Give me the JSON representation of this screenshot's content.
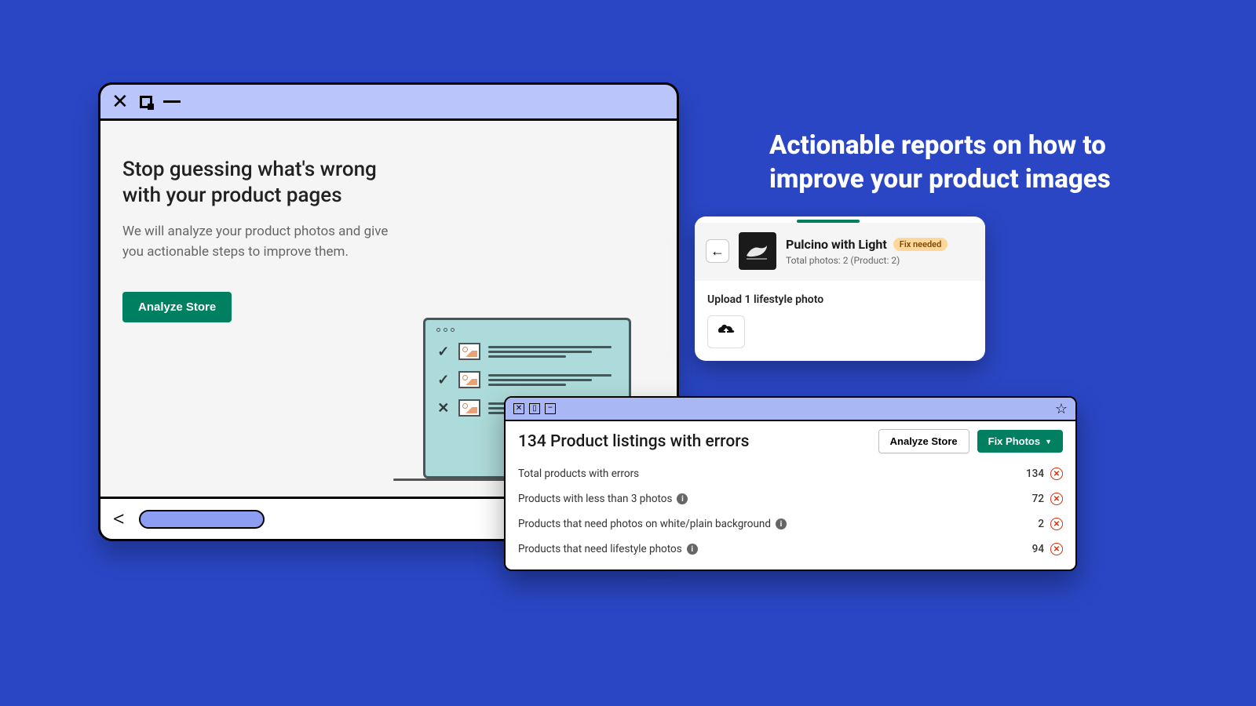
{
  "main": {
    "heading": "Stop guessing what's wrong with your product pages",
    "sub": "We will analyze your product photos and give you actionable steps to improve them.",
    "cta": "Analyze Store"
  },
  "headline": "Actionable reports on how to improve your product images",
  "product_card": {
    "title": "Pulcino with Light",
    "badge": "Fix needed",
    "sub": "Total photos: 2 (Product: 2)",
    "action": "Upload 1 lifestyle photo"
  },
  "report": {
    "title": "134 Product listings with errors",
    "analyze_btn": "Analyze Store",
    "fix_btn": "Fix Photos",
    "rows": [
      {
        "label": "Total products with errors",
        "info": false,
        "value": "134"
      },
      {
        "label": "Products with less than 3 photos",
        "info": true,
        "value": "72"
      },
      {
        "label": "Products that need photos on white/plain background",
        "info": true,
        "value": "2"
      },
      {
        "label": "Products that need lifestyle photos",
        "info": true,
        "value": "94"
      }
    ]
  }
}
